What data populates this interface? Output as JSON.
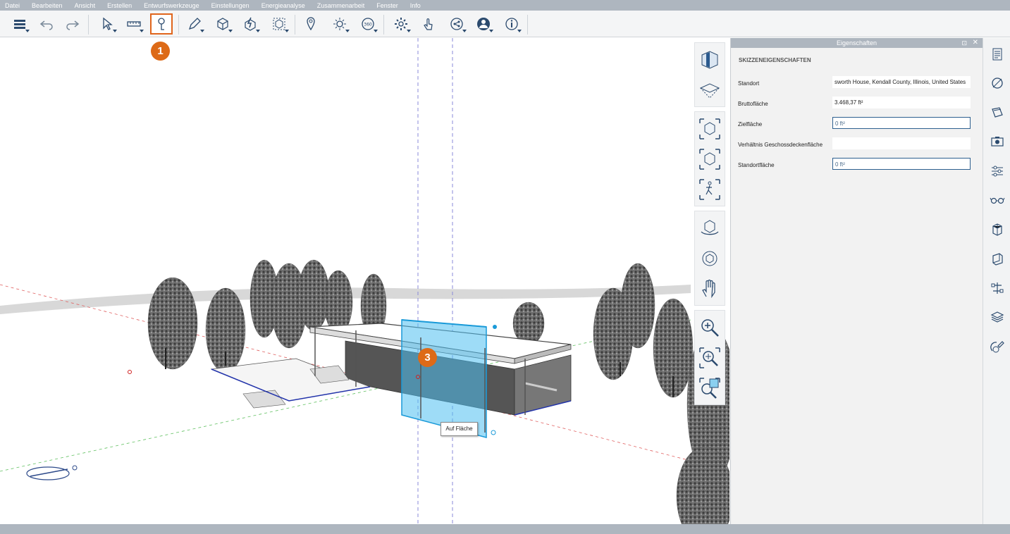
{
  "menu": {
    "items": [
      "Datei",
      "Bearbeiten",
      "Ansicht",
      "Erstellen",
      "Entwurfswerkzeuge",
      "Einstellungen",
      "Energieanalyse",
      "Zusammenarbeit",
      "Fenster",
      "Info"
    ]
  },
  "toolbar": {
    "tools": [
      {
        "name": "menu-stack-icon",
        "dropdown": true
      },
      {
        "name": "undo-icon",
        "dropdown": false
      },
      {
        "name": "redo-icon",
        "dropdown": false
      },
      {
        "name": "select-arrow-icon",
        "dropdown": true
      },
      {
        "name": "measure-icon",
        "dropdown": true
      },
      {
        "name": "sketch-tool-icon",
        "dropdown": false,
        "highlighted": true
      },
      {
        "name": "pencil-icon",
        "dropdown": true
      },
      {
        "name": "box-icon",
        "dropdown": true
      },
      {
        "name": "modify-icon",
        "dropdown": true
      },
      {
        "name": "view-icon",
        "dropdown": true
      },
      {
        "name": "location-pin-icon",
        "dropdown": false
      },
      {
        "name": "sun-icon",
        "dropdown": true
      },
      {
        "name": "orbit-360-icon",
        "dropdown": true
      },
      {
        "name": "gear-icon",
        "dropdown": true
      },
      {
        "name": "hand-touch-icon",
        "dropdown": false
      },
      {
        "name": "share-icon",
        "dropdown": true
      },
      {
        "name": "user-icon",
        "dropdown": true
      },
      {
        "name": "info-icon",
        "dropdown": true
      }
    ],
    "accent": "#e0651c"
  },
  "badges": {
    "step1": "1",
    "step3": "3",
    "color": "#dd6a17"
  },
  "viewport": {
    "tooltip": "Auf Fläche",
    "nav_groups": [
      [
        "view-cube-front-icon",
        "view-cube-top-icon"
      ],
      [
        "zoom-extent-box-icon",
        "zoom-box-icon",
        "walk-icon"
      ],
      [
        "orbit-icon",
        "look-icon",
        "pan-hand-icon"
      ],
      [
        "zoom-in-icon",
        "zoom-window-icon",
        "zoom-selection-icon"
      ]
    ]
  },
  "properties": {
    "title": "Eigenschaften",
    "pin": "⊡",
    "close": "✕",
    "section": "SKIZZENEIGENSCHAFTEN",
    "rows": [
      {
        "label": "Standort",
        "value": "sworth House, Kendall County, Illinois, United States",
        "editable": false
      },
      {
        "label": "Bruttofläche",
        "value": "3.468,37 ft²",
        "editable": false
      },
      {
        "label": "Zielfläche",
        "value": "0 ft²",
        "editable": true
      },
      {
        "label": "Verhältnis Geschossdeckenfläche",
        "value": "",
        "editable": false
      },
      {
        "label": "Standortfläche",
        "value": "0 ft²",
        "editable": true
      }
    ]
  },
  "side_panel": {
    "icons": [
      "properties-list-icon",
      "materials-icon",
      "styles-icon",
      "camera-icon",
      "settings-sliders-icon",
      "glasses-icon",
      "render-icon",
      "section-icon",
      "hierarchy-icon",
      "layers-icon",
      "paint-icon"
    ]
  }
}
